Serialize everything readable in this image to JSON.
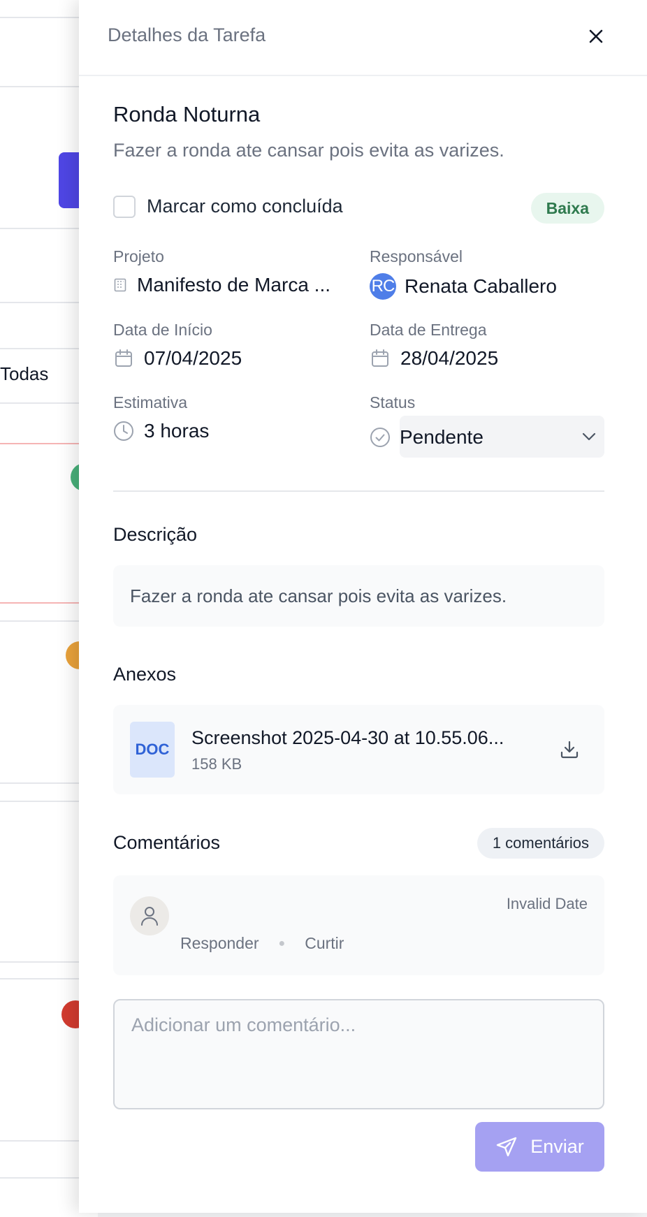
{
  "background": {
    "filter_text": "Todas"
  },
  "drawer": {
    "title": "Detalhes da Tarefa",
    "task": {
      "title": "Ronda Noturna",
      "subtitle": "Fazer a ronda ate cansar pois evita as varizes.",
      "mark_done_label": "Marcar como concluída",
      "priority": "Baixa"
    },
    "fields": {
      "project_label": "Projeto",
      "project_value": "Manifesto de Marca ...",
      "assignee_label": "Responsável",
      "assignee_initials": "RC",
      "assignee_name": "Renata Caballero",
      "start_label": "Data de Início",
      "start_value": "07/04/2025",
      "due_label": "Data de Entrega",
      "due_value": "28/04/2025",
      "estimate_label": "Estimativa",
      "estimate_value": "3 horas",
      "status_label": "Status",
      "status_value": "Pendente"
    },
    "description": {
      "title": "Descrição",
      "text": "Fazer a ronda ate cansar pois evita as varizes."
    },
    "attachments": {
      "title": "Anexos",
      "items": [
        {
          "type": "DOC",
          "name": "Screenshot 2025-04-30 at 10.55.06...",
          "size": "158 KB"
        }
      ]
    },
    "comments": {
      "title": "Comentários",
      "count_label": "1 comentários",
      "items": [
        {
          "date": "Invalid Date",
          "reply_label": "Responder",
          "like_label": "Curtir"
        }
      ],
      "input_placeholder": "Adicionar um comentário...",
      "send_label": "Enviar"
    }
  },
  "colors": {
    "accent": "#4f46e5",
    "send_button": "#a5a1f2",
    "priority_bg": "#e8f6ee",
    "priority_text": "#2f7a4e",
    "avatar": "#4f7ee8"
  }
}
